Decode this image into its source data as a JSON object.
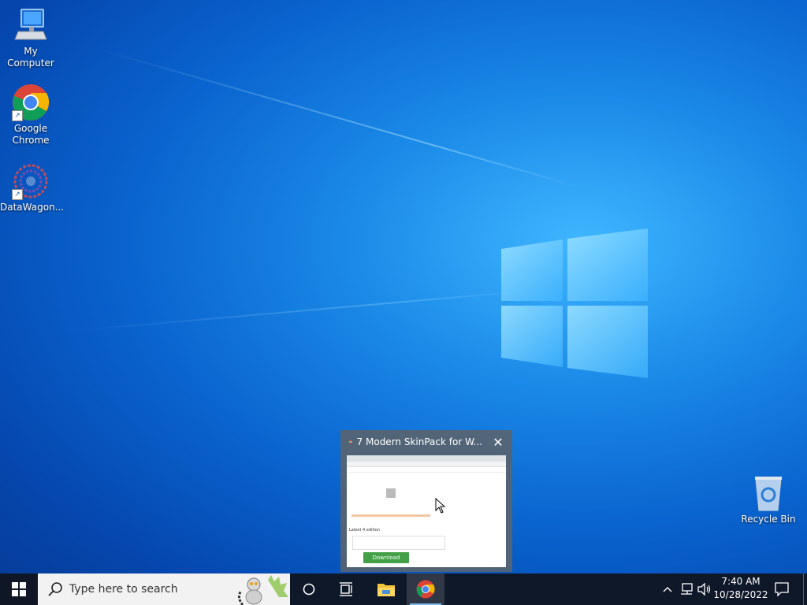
{
  "desktop": {
    "icons": [
      {
        "label": "My Computer"
      },
      {
        "label": "Google Chrome"
      },
      {
        "label": "DataWagon..."
      },
      {
        "label": "Recycle Bin"
      }
    ]
  },
  "preview": {
    "title": "7 Modern SkinPack for W...",
    "thumbnail": {
      "download_label": "Download",
      "section_label": "Latest 4 edition"
    }
  },
  "taskbar": {
    "search_placeholder": "Type here to search",
    "clock_time": "7:40 AM",
    "clock_date": "10/28/2022"
  },
  "colors": {
    "taskbar_bg": "#101622",
    "active_indicator": "#76b9ed",
    "download_green": "#43a047"
  }
}
